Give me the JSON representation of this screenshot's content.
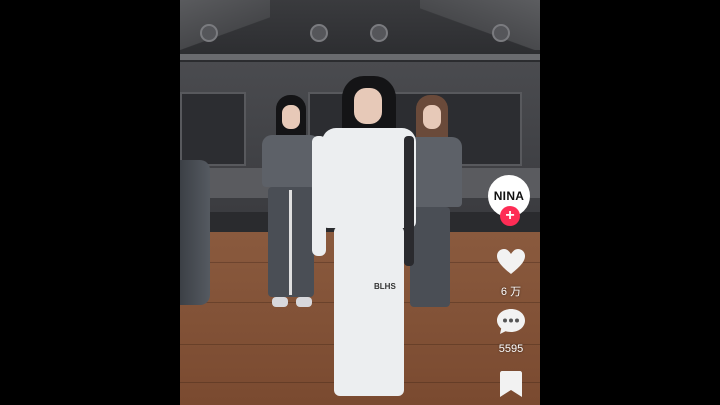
{
  "creator": {
    "avatar_text": "NINA",
    "follow_symbol": "+",
    "follow_color": "#fe2c55"
  },
  "actions": {
    "like": {
      "icon": "heart-icon",
      "count": "6 万"
    },
    "comment": {
      "icon": "comment-bubble-icon",
      "count": "5595"
    },
    "save": {
      "icon": "bookmark-icon"
    }
  },
  "video": {
    "pants_print": "BLHS"
  }
}
